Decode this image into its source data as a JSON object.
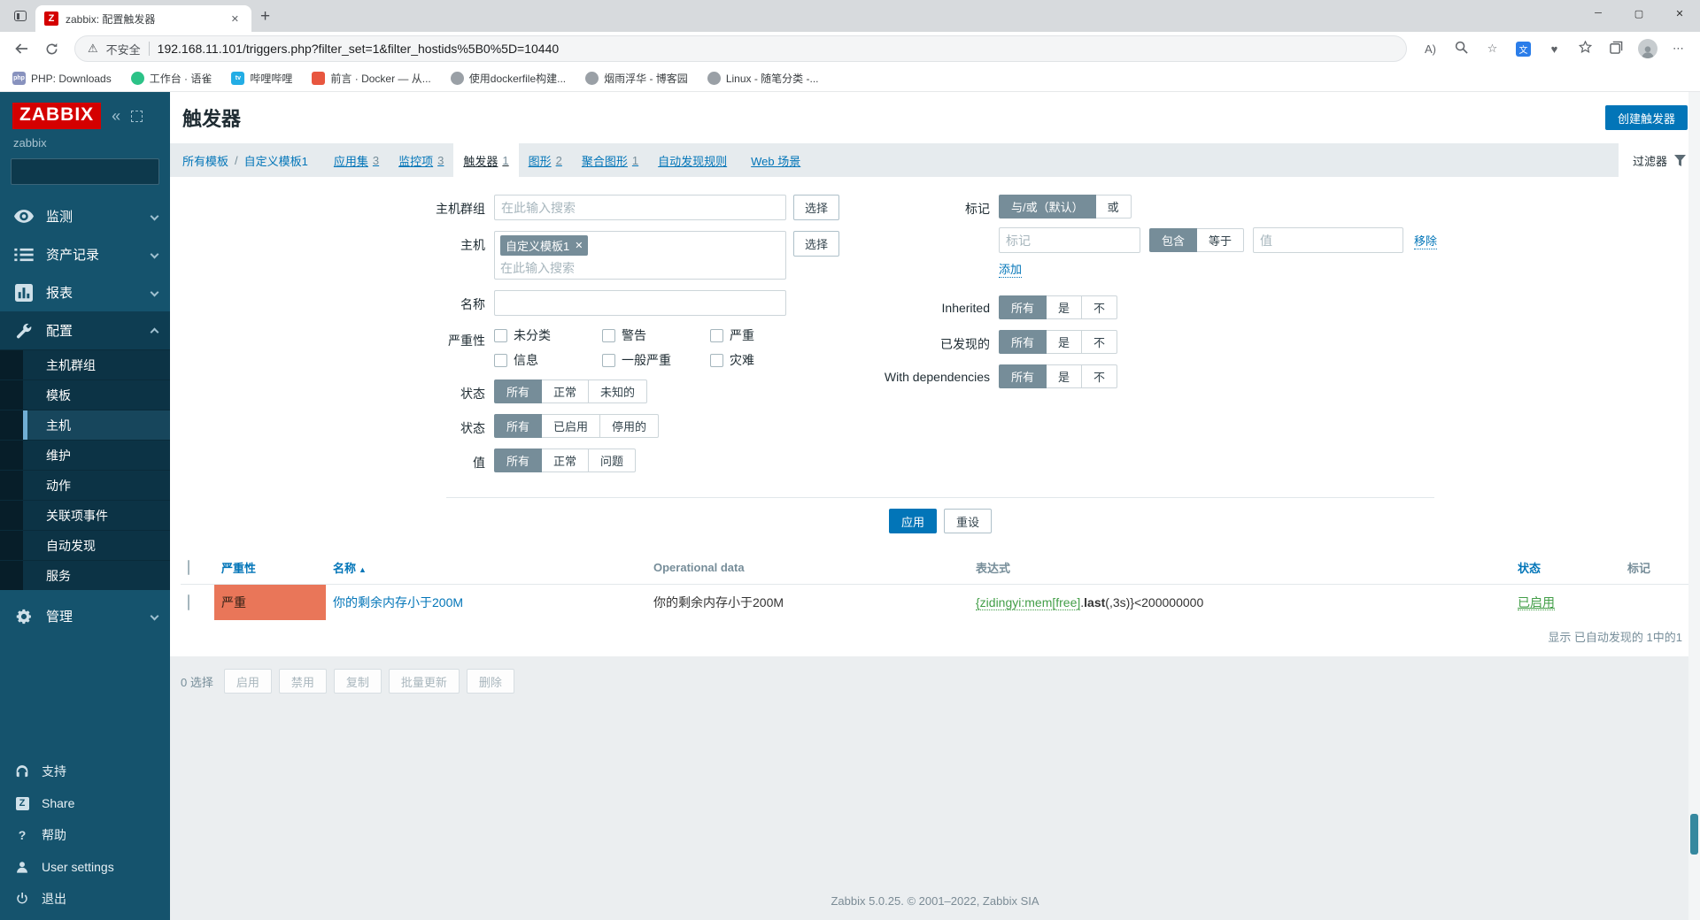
{
  "browser": {
    "window_controls": {
      "minimize": "─",
      "maximize": "▢",
      "close": "✕"
    },
    "tab": {
      "title": "zabbix: 配置触发器",
      "favicon_letter": "Z",
      "close": "✕",
      "new_tab": "+"
    },
    "nav": {
      "security_label": "不安全",
      "url": "192.168.11.101/triggers.php?filter_set=1&filter_hostids%5B0%5D=10440"
    },
    "bookmarks": [
      {
        "label": "PHP: Downloads"
      },
      {
        "label": "工作台 · 语雀"
      },
      {
        "label": "哔哩哔哩"
      },
      {
        "label": "前言 · Docker — 从..."
      },
      {
        "label": "使用dockerfile构建..."
      },
      {
        "label": "烟雨浮华 - 博客园"
      },
      {
        "label": "Linux - 随笔分类 -..."
      }
    ]
  },
  "sidebar": {
    "logo": "ZABBIX",
    "server_name": "zabbix",
    "menu": [
      {
        "label": "监测"
      },
      {
        "label": "资产记录"
      },
      {
        "label": "报表"
      },
      {
        "label": "配置"
      },
      {
        "label": "管理"
      }
    ],
    "submenu": [
      {
        "label": "主机群组"
      },
      {
        "label": "模板"
      },
      {
        "label": "主机"
      },
      {
        "label": "维护"
      },
      {
        "label": "动作"
      },
      {
        "label": "关联项事件"
      },
      {
        "label": "自动发现"
      },
      {
        "label": "服务"
      }
    ],
    "footer": [
      {
        "label": "支持"
      },
      {
        "label": "Share"
      },
      {
        "label": "帮助"
      },
      {
        "label": "User settings"
      },
      {
        "label": "退出"
      }
    ]
  },
  "header": {
    "title": "触发器",
    "create_button": "创建触发器"
  },
  "nav_tabs": {
    "breadcrumb": [
      {
        "label": "所有模板"
      },
      {
        "label": "自定义模板1"
      }
    ],
    "separator": "/",
    "tabs": [
      {
        "label": "应用集",
        "count": "3"
      },
      {
        "label": "监控项",
        "count": "3"
      },
      {
        "label": "触发器",
        "count": "1"
      },
      {
        "label": "图形",
        "count": "2"
      },
      {
        "label": "聚合图形",
        "count": "1"
      },
      {
        "label": "自动发现规则",
        "count": ""
      },
      {
        "label": "Web 场景",
        "count": ""
      }
    ],
    "filter_label": "过滤器"
  },
  "filter": {
    "host_group": {
      "label": "主机群组",
      "placeholder": "在此输入搜索",
      "select_button": "选择"
    },
    "host": {
      "label": "主机",
      "chip": "自定义模板1",
      "chip_close": "✕",
      "placeholder": "在此输入搜索",
      "select_button": "选择"
    },
    "name": {
      "label": "名称"
    },
    "severity": {
      "label": "严重性",
      "options": [
        [
          "未分类",
          "警告",
          "严重"
        ],
        [
          "信息",
          "一般严重",
          "灾难"
        ]
      ]
    },
    "state": {
      "label": "状态",
      "options": [
        "所有",
        "正常",
        "未知的"
      ]
    },
    "status": {
      "label": "状态",
      "options": [
        "所有",
        "已启用",
        "停用的"
      ]
    },
    "value": {
      "label": "值",
      "options": [
        "所有",
        "正常",
        "问题"
      ]
    },
    "tags": {
      "label": "标记",
      "mode_options": [
        "与/或（默认）",
        "或"
      ],
      "tag_placeholder": "标记",
      "op_options": [
        "包含",
        "等于"
      ],
      "value_placeholder": "值",
      "remove_link": "移除",
      "add_link": "添加"
    },
    "inherited": {
      "label": "Inherited",
      "options": [
        "所有",
        "是",
        "不"
      ]
    },
    "discovered": {
      "label": "已发现的",
      "options": [
        "所有",
        "是",
        "不"
      ]
    },
    "dependencies": {
      "label": "With dependencies",
      "options": [
        "所有",
        "是",
        "不"
      ]
    },
    "apply_button": "应用",
    "reset_button": "重设"
  },
  "table": {
    "headers": {
      "severity": "严重性",
      "name": "名称",
      "sort_arrow": "▲",
      "opdata": "Operational data",
      "expression": "表达式",
      "status": "状态",
      "tags": "标记"
    },
    "rows": [
      {
        "severity": "严重",
        "name": "你的剩余内存小于200M",
        "opdata": "你的剩余内存小于200M",
        "expr_item": "{zidingyi:mem[free]",
        "expr_dot": ".",
        "expr_func": "last",
        "expr_tail": "(,3s)}<200000000",
        "status": "已启用"
      }
    ],
    "summary": "显示 已自动发现的 1中的1"
  },
  "bulk": {
    "selected": "0 选择",
    "buttons": [
      "启用",
      "禁用",
      "复制",
      "批量更新",
      "删除"
    ]
  },
  "footer": {
    "text": "Zabbix 5.0.25. © 2001–2022, Zabbix SIA"
  },
  "colors": {
    "accent_blue": "#0275b8",
    "severity_high": "#e97659",
    "green_link": "#429e47",
    "logo_red": "#d40000",
    "segment_active": "#768d99",
    "sidebar_bg": "#15536d"
  }
}
